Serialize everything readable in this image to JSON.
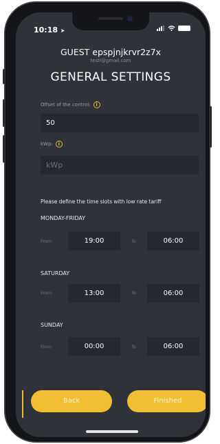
{
  "status_bar": {
    "time": "10:18",
    "signal": "signal-icon",
    "wifi": "wifi-icon",
    "battery": "battery-icon"
  },
  "header": {
    "guest_name": "GUEST epspjnjkrvr2z7x",
    "email": "testl@gmail.com",
    "title": "GENERAL SETTINGS"
  },
  "fields": {
    "offset_label": "Offset of the control:",
    "offset_value": "50",
    "kwp_label": "kWp:",
    "kwp_placeholder": "kWp"
  },
  "tariff": {
    "note": "Please define the time slots with low rate tariff",
    "from_label": "From",
    "to_label": "To",
    "days": [
      {
        "name": "MONDAY-FRIDAY",
        "from": "19:00",
        "to": "06:00"
      },
      {
        "name": "SATURDAY",
        "from": "13:00",
        "to": "06:00"
      },
      {
        "name": "SUNDAY",
        "from": "00:00",
        "to": "06:00"
      }
    ]
  },
  "buttons": {
    "back": "Back",
    "finished": "Finished"
  },
  "colors": {
    "accent": "#f0bd33",
    "background": "#2f3238",
    "field": "#25282e"
  }
}
